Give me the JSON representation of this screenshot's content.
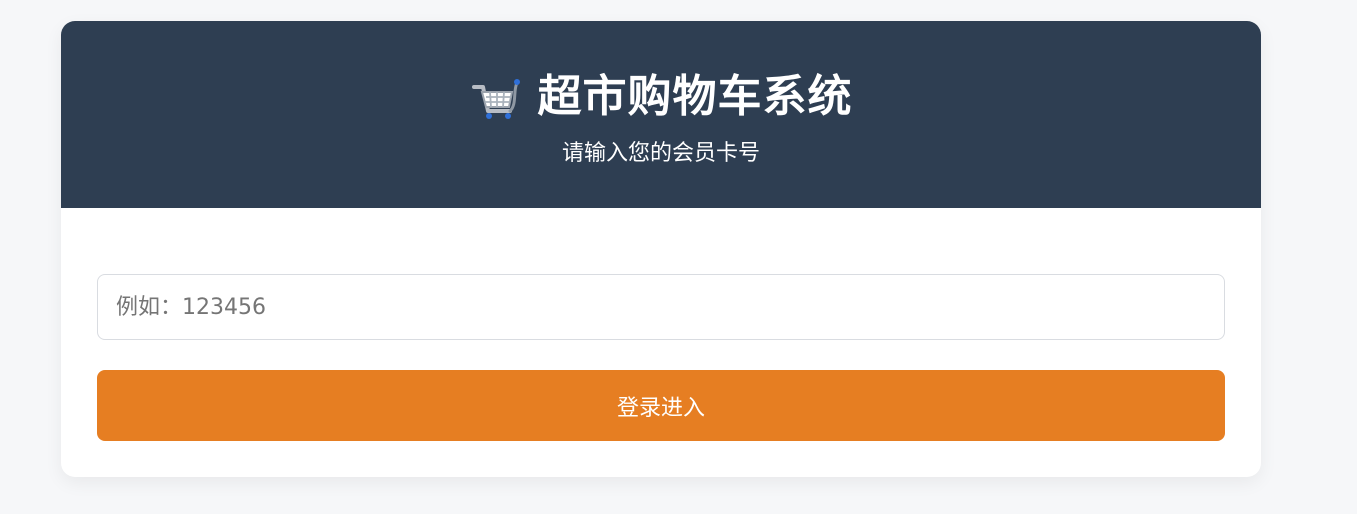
{
  "header": {
    "title": "超市购物车系统",
    "subtitle": "请输入您的会员卡号",
    "icon": "shopping-cart-icon",
    "background": "#2e3e52"
  },
  "form": {
    "member_card_input": {
      "placeholder": "例如：123456",
      "value": ""
    },
    "login_button": {
      "label": "登录进入",
      "color": "#e67e22"
    }
  }
}
